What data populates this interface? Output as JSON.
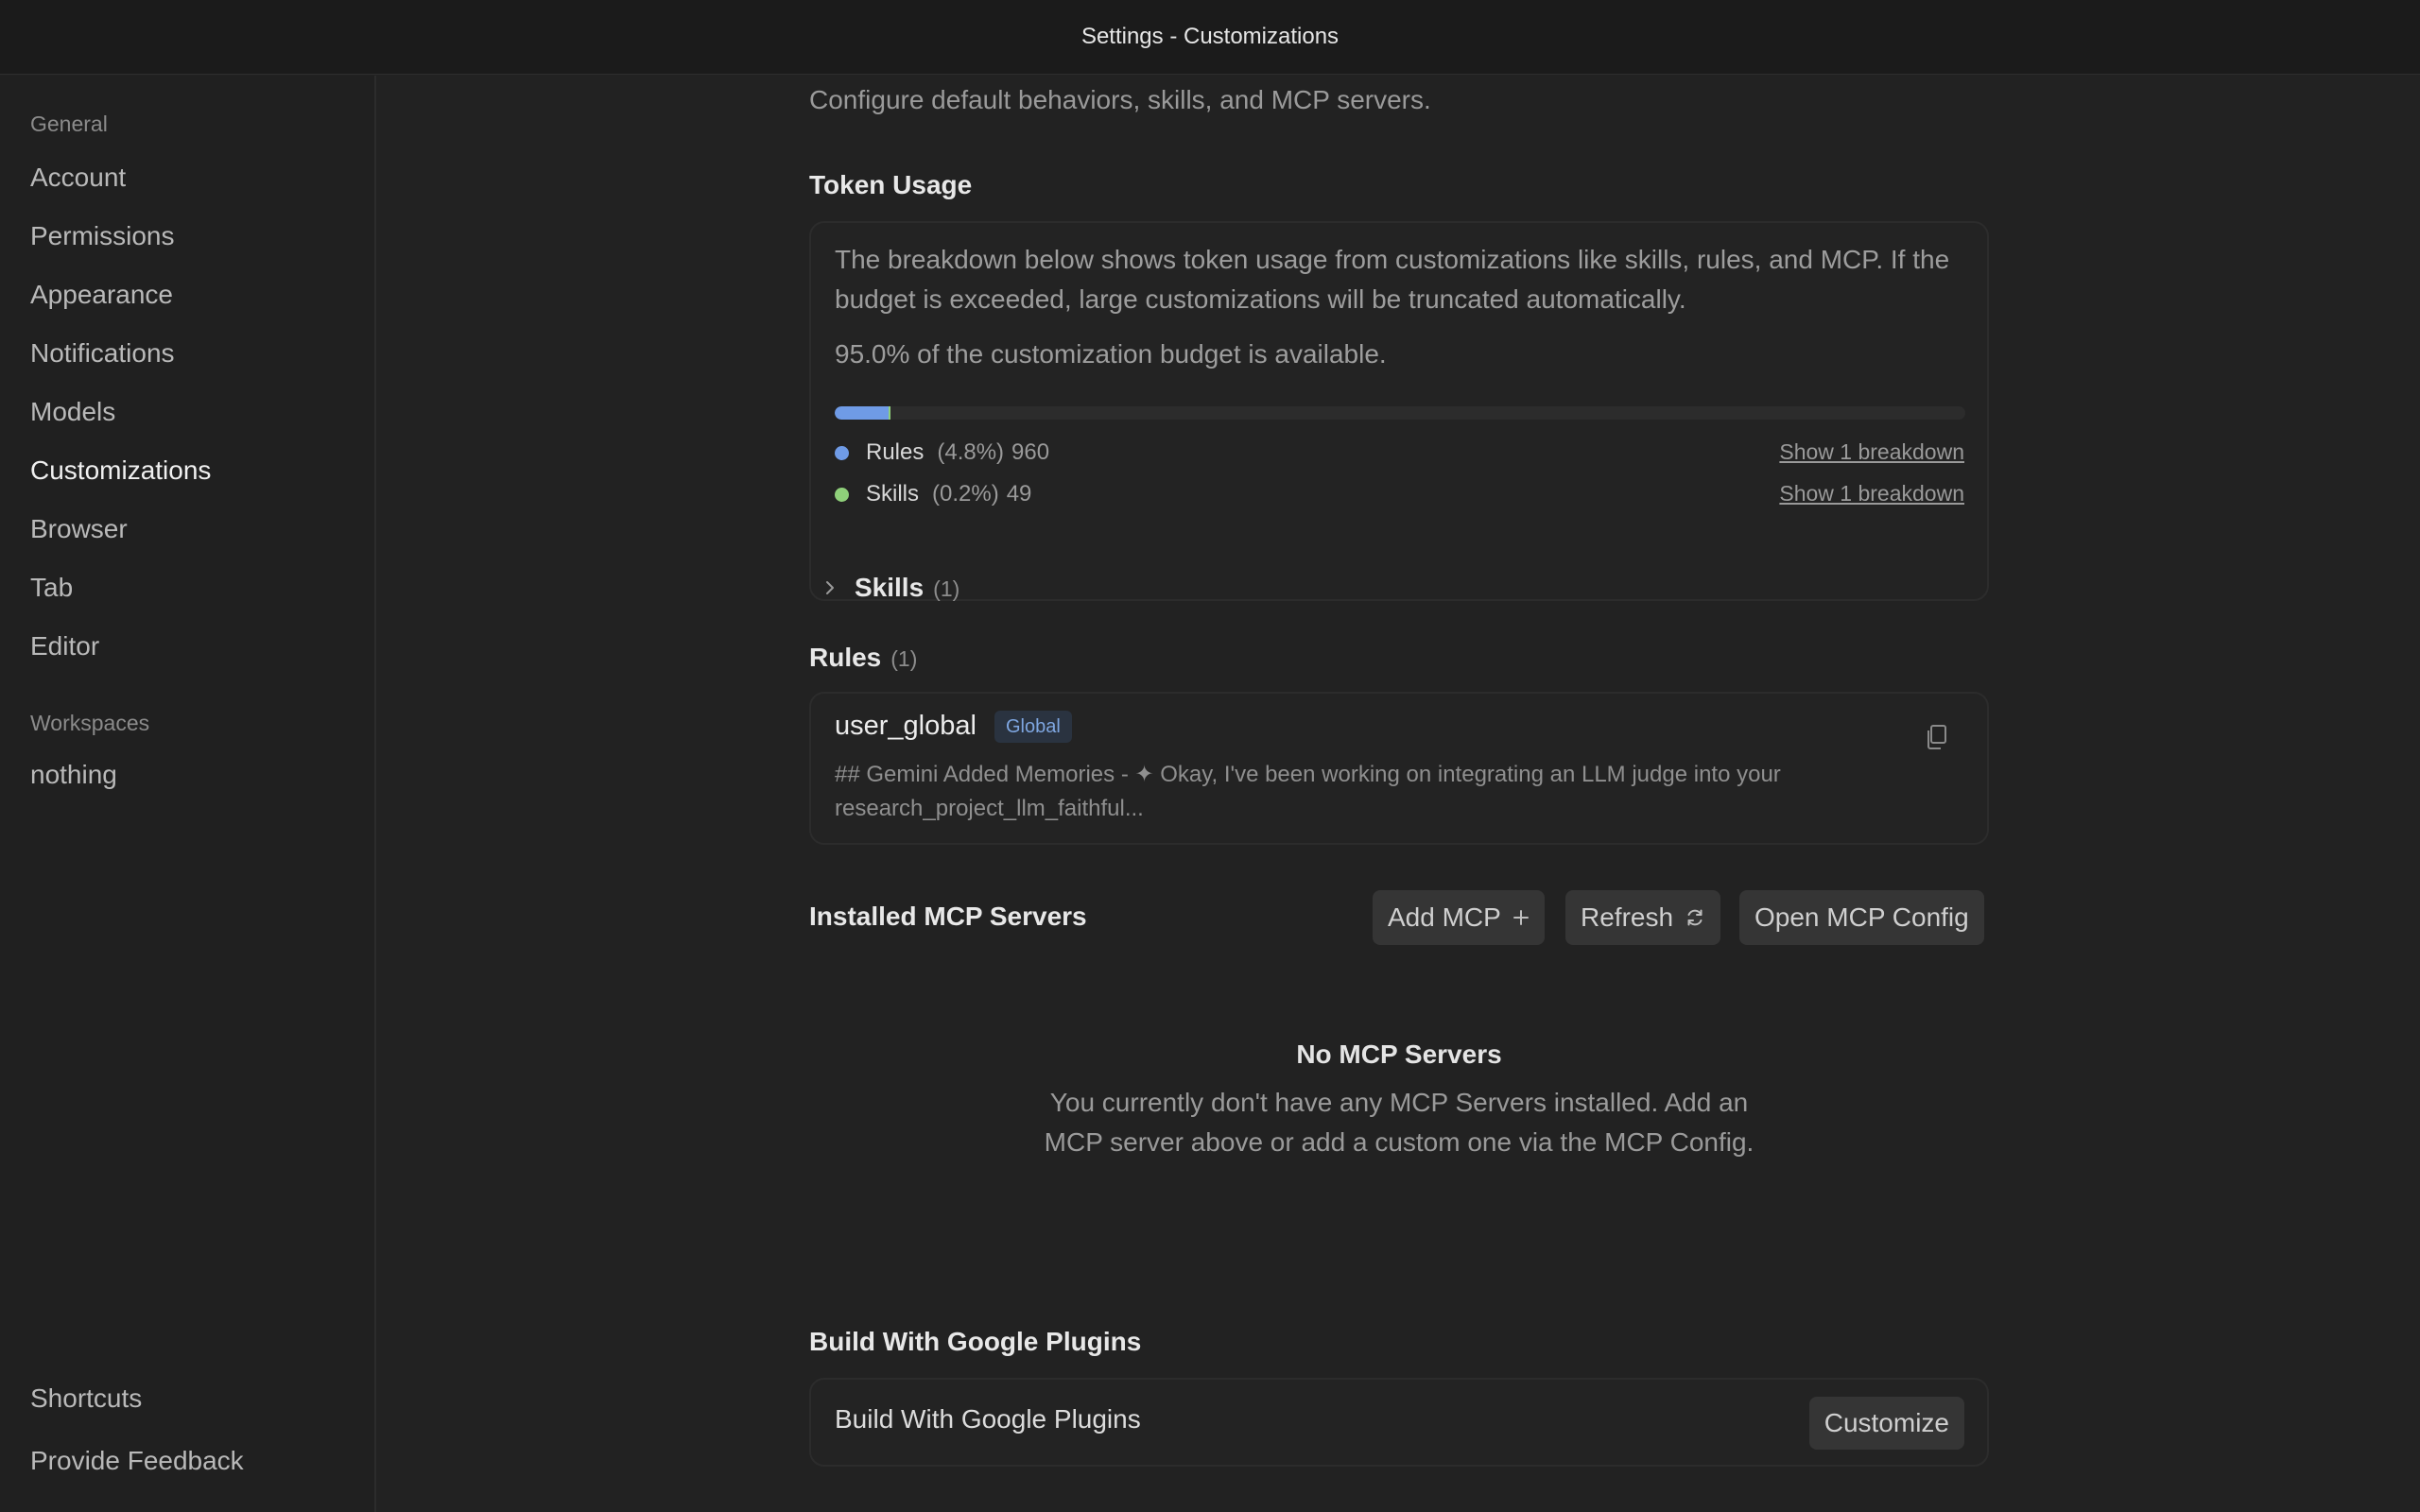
{
  "window": {
    "title": "Settings - Customizations"
  },
  "sidebar": {
    "general_heading": "General",
    "general_items": [
      "Account",
      "Permissions",
      "Appearance",
      "Notifications",
      "Models",
      "Customizations",
      "Browser",
      "Tab",
      "Editor"
    ],
    "active_item": "Customizations",
    "workspaces_heading": "Workspaces",
    "workspace_items": [
      "nothing"
    ],
    "footer_items": [
      "Shortcuts",
      "Provide Feedback"
    ]
  },
  "main": {
    "subtitle": "Configure default behaviors, skills, and MCP servers.",
    "token_usage": {
      "title": "Token Usage",
      "description": "The breakdown below shows token usage from customizations like skills, rules, and MCP. If the budget is exceeded, large customizations will be truncated automatically.",
      "available_text": "95.0% of the customization budget is available.",
      "items": [
        {
          "name": "Rules",
          "percent": "(4.8%)",
          "tokens": "960",
          "share": 0.048,
          "color": "#6f9be6",
          "link": "Show 1 breakdown"
        },
        {
          "name": "Skills",
          "percent": "(0.2%)",
          "tokens": "49",
          "share": 0.002,
          "color": "#8fd07a",
          "link": "Show 1 breakdown"
        }
      ]
    },
    "skills": {
      "title": "Skills",
      "count": "(1)"
    },
    "rules": {
      "title": "Rules",
      "count": "(1)",
      "rule": {
        "name": "user_global",
        "badge": "Global",
        "preview": "## Gemini Added Memories - ✦ Okay, I've been working on integrating an LLM judge into your research_project_llm_faithful..."
      }
    },
    "mcp": {
      "title": "Installed MCP Servers",
      "add_label": "Add MCP",
      "refresh_label": "Refresh",
      "config_label": "Open MCP Config",
      "empty_title": "No MCP Servers",
      "empty_desc": "You currently don't have any MCP Servers installed. Add an MCP server above or add a custom one via the MCP Config."
    },
    "plugins": {
      "title": "Build With Google Plugins",
      "row_label": "Build With Google Plugins",
      "customize_label": "Customize"
    }
  }
}
